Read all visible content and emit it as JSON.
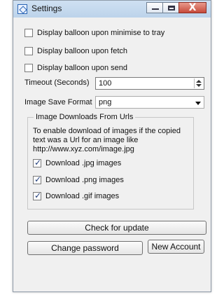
{
  "window": {
    "title": "Settings",
    "buttons": {
      "minimize": "—",
      "maximize": "□",
      "close": "X"
    }
  },
  "options": {
    "balloon_minimise": {
      "label": "Display balloon upon minimise to tray",
      "checked": false
    },
    "balloon_fetch": {
      "label": "Display balloon upon fetch",
      "checked": false
    },
    "balloon_send": {
      "label": "Display balloon upon send",
      "checked": false
    }
  },
  "timeout": {
    "label": "Timeout (Seconds)",
    "value": "100"
  },
  "image_save_format": {
    "label": "Image Save Format",
    "value": "png"
  },
  "image_downloads": {
    "title": "Image Downloads From Urls",
    "description": "To enable download of images if the copied\ntext was a Url for an image like\nhttp://www.xyz.com/image.jpg",
    "jpg": {
      "label": "Download .jpg images",
      "checked": true
    },
    "png": {
      "label": "Download .png images",
      "checked": true
    },
    "gif": {
      "label": "Download .gif images",
      "checked": true
    }
  },
  "buttons": {
    "check_update": "Check for update",
    "change_password": "Change password",
    "new_account": "New Account"
  },
  "icons": {
    "app": "settings-app-icon",
    "spinner_up": "spinner-up-icon",
    "spinner_down": "spinner-down-icon",
    "dropdown": "chevron-down-icon"
  }
}
